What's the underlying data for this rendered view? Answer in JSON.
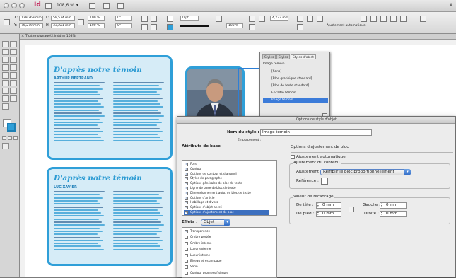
{
  "titlebar": {
    "app_logo": "Id",
    "zoom": "108,6 %",
    "right_text": "A"
  },
  "controlbar": {
    "x": "129,269 mm",
    "y": "76,279 mm",
    "w": "59,574 mm",
    "h": "33,221 mm",
    "scale_x": "100 %",
    "scale_y": "100 %",
    "angle": "0°",
    "shear": "0°",
    "stroke_weight": "0 pt",
    "opacity": "100 %",
    "gap": "4,233 mm",
    "auto_fit": "Ajustement automatique"
  },
  "document_tab": {
    "label": "Tic\\temoignage\\2.indd @ 108%"
  },
  "page": {
    "card1": {
      "title": "D'après notre témoin",
      "name": "Arthur Bertrand"
    },
    "card2": {
      "title": "D'après notre témoin",
      "name": "Luc Xavier"
    }
  },
  "styles_panel": {
    "tabs": [
      "Styles",
      "Styles",
      "Styles d'objet"
    ],
    "header": "Image témoin",
    "items": [
      "[Sans]",
      "[Bloc graphique standard]",
      "[Bloc de texte standard]",
      "Encadré témoin",
      "Image témoin"
    ]
  },
  "dialog": {
    "title": "Options de style d'objet",
    "style_name_label": "Nom du style :",
    "style_name_value": "Image témoin",
    "location_label": "Emplacement :",
    "base_attrs_label": "Attributs de base",
    "attrs": [
      "Fond",
      "Contour",
      "Options de contour et d'arrondi",
      "Styles de paragraphe",
      "Options générales de bloc de texte",
      "Ligne de base de bloc de texte",
      "Dimensionnement auto. de bloc de texte",
      "Options d'article",
      "Habillage et divers",
      "Options d'objet ancré",
      "Options d'ajustement de bloc"
    ],
    "effects_label": "Effets :",
    "effects_value": "Objet",
    "effects": [
      "Transparence",
      "Ombre portée",
      "Ombre interne",
      "Lueur externe",
      "Lueur interne",
      "Biseau et estampage",
      "Satin",
      "Contour progressif simple"
    ],
    "section_title": "Options d'ajustement de bloc",
    "auto_fit": "Ajustement automatique",
    "content_fit_title": "Ajustement du contenu",
    "fit_label": "Ajustement :",
    "fit_value": "Remplir le bloc proportionnellement",
    "ref_label": "Référence :",
    "crop_title": "Valeur de recadrage",
    "top_label": "De tête :",
    "top_value": "0 mm",
    "bottom_label": "De pied :",
    "bottom_value": "0 mm",
    "left_label": "Gauche :",
    "left_value": "0 mm",
    "right_label": "Droite :",
    "right_value": "0 mm"
  }
}
